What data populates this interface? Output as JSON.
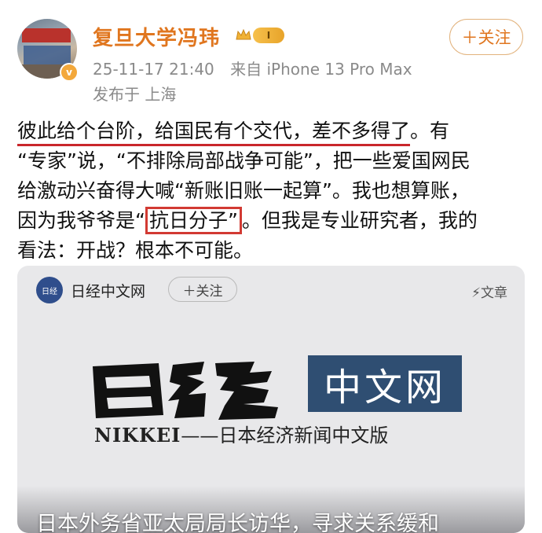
{
  "user": {
    "name": "复旦大学冯玮",
    "level_badge": "I",
    "follow_label": "＋关注",
    "verified_mark": "v",
    "avatar_icon": "avatar-photo"
  },
  "meta": {
    "datetime": "25-11-17 21:40",
    "device": "来自 iPhone 13 Pro Max",
    "location": "发布于 上海"
  },
  "post": {
    "l1a": "彼此给个台阶，给国民有个交代，差不多得了",
    "l1b": "。有",
    "l2": "“专家”说，“不排除局部战争可能”，把一些爱国网民",
    "l3": "给激动兴奋得大喊“新账旧账一起算”。我也想算账，",
    "l4a": "因为我爷爷是“",
    "l4b": "抗日分子”",
    "l4c": "。但我是专业研究者，我的",
    "l5": "看法：开战？根本不可能。"
  },
  "card": {
    "source_name": "日经中文网",
    "logo_text": "日经",
    "follow_label": "＋关注",
    "type_label": "文章",
    "type_icon": "lightning-icon",
    "zhongwen": "中文网",
    "nikkei_en": "NIKKEI",
    "nikkei_cn": "——日本经济新闻中文版",
    "headline": "日本外务省亚太局局长访华，寻求关系缓和"
  },
  "colors": {
    "username": "#e0761f",
    "highlight": "#c9262b",
    "nikkei_blue": "#2f4e72"
  }
}
